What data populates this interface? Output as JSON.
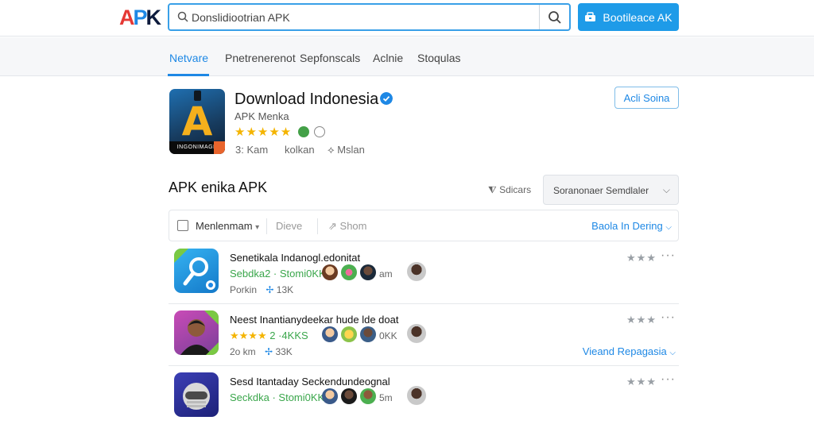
{
  "header": {
    "logo": {
      "part1": "A",
      "part2": "P",
      "part3": "K"
    },
    "search_value": "Donslidiootrian APK",
    "download_button": "Bootileace AK"
  },
  "nav": {
    "tabs": [
      {
        "label": "Netvare",
        "active": true
      },
      {
        "label": "Pnetrenerenot",
        "active": false
      },
      {
        "label": "Sepfonscals",
        "active": false
      },
      {
        "label": "Aclnie",
        "active": false
      },
      {
        "label": "Stoqulas",
        "active": false
      }
    ]
  },
  "app": {
    "icon_strip_text": "INGONIMAGE",
    "title": "Download Indonesia",
    "subtitle": "APK Menka",
    "stars": "★★★★★",
    "meta": [
      "3: Kam",
      "kolkan",
      "Mslan"
    ],
    "add_button": "Acli Soina"
  },
  "section": {
    "title": "APK enika APK",
    "sort_label": "Sdicars",
    "sort_value": "Soranonaer Semdlaler"
  },
  "toolbar": {
    "select_label": "Menlenmam",
    "btn_1": "Dieve",
    "btn_2": "Shom",
    "right_link": "Baola In Dering"
  },
  "rows": [
    {
      "title": "Senetikala Indanogl.edonitat",
      "line2": "Sebdka2 · Stomi0KK",
      "size": "am",
      "line3_left": "Porkin",
      "line3_right": "13K",
      "rating": "★★★",
      "link": ""
    },
    {
      "title": "Neest Inantianydeekar hude lde doat",
      "line2_stars": "★★★★",
      "line2": "2 ·4KKS",
      "size": "0KK",
      "line3_left": "2o km",
      "line3_right": "33K",
      "rating": "★★★",
      "link": "Vieand Repagasia"
    },
    {
      "title": "Sesd Itantaday Seckendundeognal",
      "line2": "Seckdka · Stomi0KK",
      "size": "5m",
      "line3_left": "",
      "line3_right": "",
      "rating": "★★★",
      "link": ""
    }
  ],
  "colors": {
    "accent": "#1e88e5",
    "download_button": "#1e9be8",
    "star": "#f4b400",
    "green_text": "#3aa64b"
  }
}
